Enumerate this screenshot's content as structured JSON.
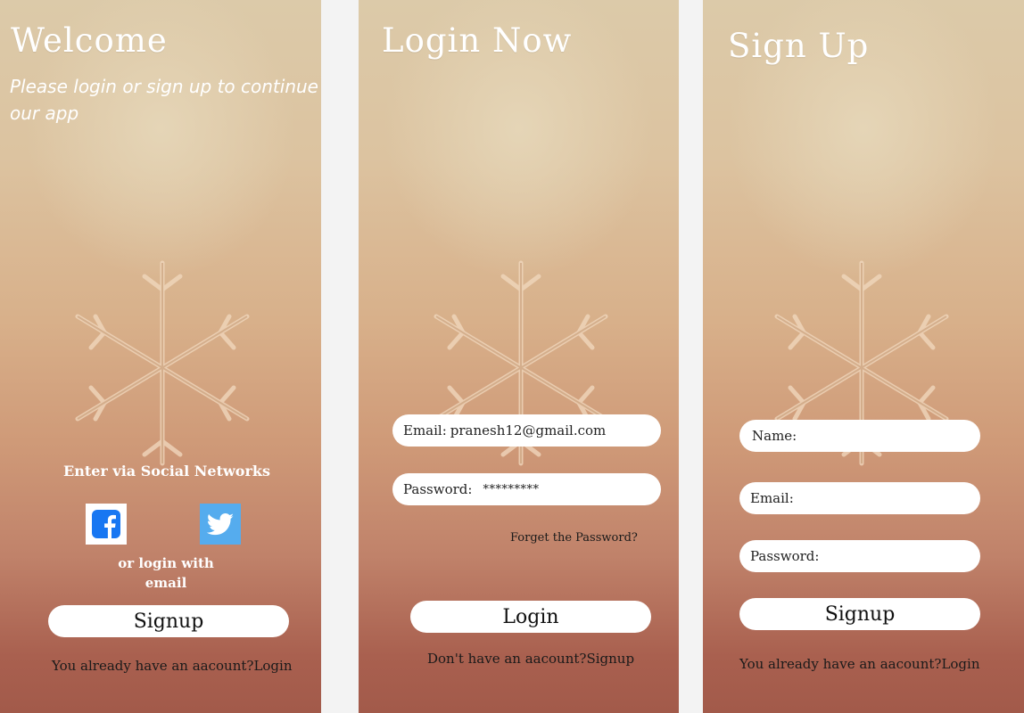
{
  "welcome": {
    "title": "Welcome",
    "subtitle": "Please login or sign up to continue our app",
    "social_heading": "Enter via Social Networks",
    "social": {
      "facebook_icon": "facebook-icon",
      "twitter_icon": "twitter-icon"
    },
    "or_login_with_email": "or login with email",
    "signup_label": "Signup",
    "footer_prefix": "You already have an aacount?",
    "footer_link": "Login"
  },
  "login": {
    "title": "Login Now",
    "email_label": "Email:",
    "email_value": "pranesh12@gmail.com",
    "password_label": "Password:",
    "password_value": "*********",
    "forget_label": "Forget the Password?",
    "login_label": "Login",
    "footer_prefix": "Don't have an aacount?",
    "footer_link": "Signup"
  },
  "signup": {
    "title": "Sign Up",
    "name_label": "Name:",
    "email_label": "Email:",
    "password_label": "Password:",
    "signup_label": "Signup",
    "footer_prefix": "You already have an aacount?",
    "footer_link": "Login"
  },
  "colors": {
    "page_background": "#f3f3f3",
    "facebook_blue": "#1877f2",
    "twitter_blue": "#55acee"
  }
}
